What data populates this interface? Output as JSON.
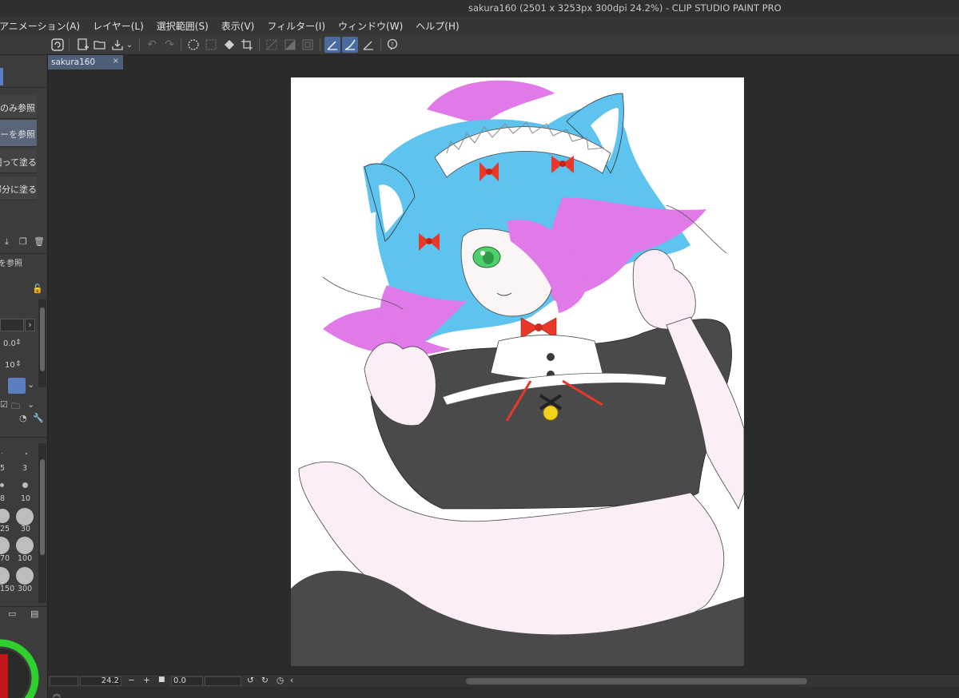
{
  "window": {
    "title": "sakura160 (2501 x 3253px 300dpi 24.2%)  - CLIP STUDIO PAINT PRO"
  },
  "menu": [
    {
      "label": "アニメーション(A)"
    },
    {
      "label": "レイヤー(L)"
    },
    {
      "label": "選択範囲(S)"
    },
    {
      "label": "表示(V)"
    },
    {
      "label": "フィルター(I)"
    },
    {
      "label": "ウィンドウ(W)"
    },
    {
      "label": "ヘルプ(H)"
    }
  ],
  "toolbar": {
    "icons": [
      "clip-studio-icon",
      "new-icon",
      "open-icon",
      "save-icon",
      "save-dropdown-icon",
      "undo-icon",
      "redo-icon",
      "clear-icon",
      "clear-outside-icon",
      "fill-icon",
      "crop-icon",
      "transform-icon",
      "deselect-icon",
      "invert-selection-icon",
      "show-selection-icon",
      "stabilizer-icon",
      "snap-icon",
      "ruler-icon",
      "assist-icon"
    ]
  },
  "document_tab": {
    "name": "sakura160",
    "close_glyph": "×"
  },
  "left_panel": {
    "fill_options": [
      {
        "label": "のみ参照",
        "selected": false
      },
      {
        "label": "ーを参照",
        "selected": true
      },
      {
        "label": "囲って塗る",
        "selected": false
      },
      {
        "label": "部分に塗る",
        "selected": false
      }
    ],
    "sub_tool_label": "を参照]",
    "tolerance": "0.0",
    "area_scaling": "10",
    "brush_sizes": [
      "5",
      "3",
      "8",
      "10",
      "25",
      "30",
      "70",
      "100",
      "150",
      "300"
    ]
  },
  "status": {
    "zoom": "24.2",
    "minus": "−",
    "plus": "+",
    "rotation": "0.0"
  },
  "colors": {
    "accent": "#4a6aa0",
    "tab": "#4f5f7a",
    "paper": "#ffffff",
    "hair_blue": "#5ec3ee",
    "hair_pink": "#e07ae8",
    "dress": "#4a4a4a",
    "apron": "#fbeef6",
    "ribbon": "#e8382a",
    "eye": "#4fd06a",
    "bell": "#f2d21a",
    "color_wheel_ring": "#2ed02e"
  }
}
